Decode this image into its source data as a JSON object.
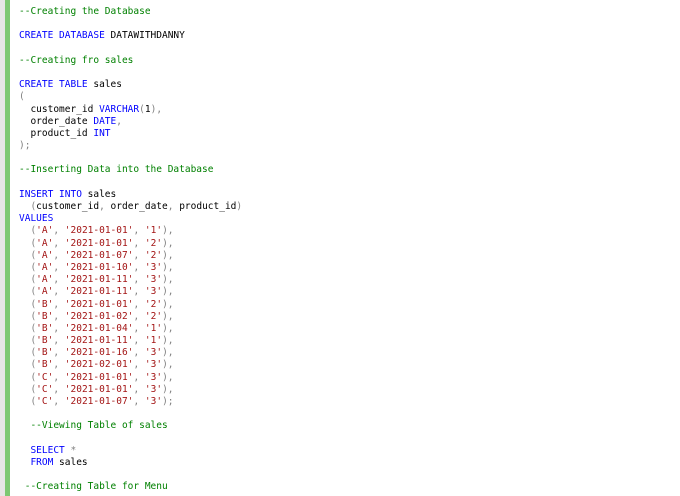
{
  "editor": {
    "lines": [
      [
        [
          "cm",
          "--Creating the Database"
        ]
      ],
      [],
      [
        [
          "kw",
          "CREATE DATABASE "
        ],
        [
          "id",
          "DATAWITHDANNY"
        ]
      ],
      [],
      [
        [
          "cm",
          "--Creating fro sales"
        ]
      ],
      [],
      [
        [
          "kw",
          "CREATE TABLE "
        ],
        [
          "id",
          "sales"
        ]
      ],
      [
        [
          "pu",
          "("
        ]
      ],
      [
        [
          "id",
          "  customer_id "
        ],
        [
          "kw",
          "VARCHAR"
        ],
        [
          "pu",
          "("
        ],
        [
          "id",
          "1"
        ],
        [
          "pu",
          "),"
        ]
      ],
      [
        [
          "id",
          "  order_date "
        ],
        [
          "kw",
          "DATE"
        ],
        [
          "pu",
          ","
        ]
      ],
      [
        [
          "id",
          "  product_id "
        ],
        [
          "kw",
          "INT"
        ]
      ],
      [
        [
          "pu",
          ");"
        ]
      ],
      [],
      [
        [
          "cm",
          "--Inserting Data into the Database"
        ]
      ],
      [],
      [
        [
          "kw",
          "INSERT INTO "
        ],
        [
          "id",
          "sales"
        ]
      ],
      [
        [
          "pu",
          "  ("
        ],
        [
          "id",
          "customer_id"
        ],
        [
          "pu",
          ", "
        ],
        [
          "id",
          "order_date"
        ],
        [
          "pu",
          ", "
        ],
        [
          "id",
          "product_id"
        ],
        [
          "pu",
          ")"
        ]
      ],
      [
        [
          "kw",
          "VALUES"
        ]
      ],
      [
        [
          "pu",
          "  ("
        ],
        [
          "st",
          "'A'"
        ],
        [
          "pu",
          ", "
        ],
        [
          "st",
          "'2021-01-01'"
        ],
        [
          "pu",
          ", "
        ],
        [
          "st",
          "'1'"
        ],
        [
          "pu",
          "),"
        ]
      ],
      [
        [
          "pu",
          "  ("
        ],
        [
          "st",
          "'A'"
        ],
        [
          "pu",
          ", "
        ],
        [
          "st",
          "'2021-01-01'"
        ],
        [
          "pu",
          ", "
        ],
        [
          "st",
          "'2'"
        ],
        [
          "pu",
          "),"
        ]
      ],
      [
        [
          "pu",
          "  ("
        ],
        [
          "st",
          "'A'"
        ],
        [
          "pu",
          ", "
        ],
        [
          "st",
          "'2021-01-07'"
        ],
        [
          "pu",
          ", "
        ],
        [
          "st",
          "'2'"
        ],
        [
          "pu",
          "),"
        ]
      ],
      [
        [
          "pu",
          "  ("
        ],
        [
          "st",
          "'A'"
        ],
        [
          "pu",
          ", "
        ],
        [
          "st",
          "'2021-01-10'"
        ],
        [
          "pu",
          ", "
        ],
        [
          "st",
          "'3'"
        ],
        [
          "pu",
          "),"
        ]
      ],
      [
        [
          "pu",
          "  ("
        ],
        [
          "st",
          "'A'"
        ],
        [
          "pu",
          ", "
        ],
        [
          "st",
          "'2021-01-11'"
        ],
        [
          "pu",
          ", "
        ],
        [
          "st",
          "'3'"
        ],
        [
          "pu",
          "),"
        ]
      ],
      [
        [
          "pu",
          "  ("
        ],
        [
          "st",
          "'A'"
        ],
        [
          "pu",
          ", "
        ],
        [
          "st",
          "'2021-01-11'"
        ],
        [
          "pu",
          ", "
        ],
        [
          "st",
          "'3'"
        ],
        [
          "pu",
          "),"
        ]
      ],
      [
        [
          "pu",
          "  ("
        ],
        [
          "st",
          "'B'"
        ],
        [
          "pu",
          ", "
        ],
        [
          "st",
          "'2021-01-01'"
        ],
        [
          "pu",
          ", "
        ],
        [
          "st",
          "'2'"
        ],
        [
          "pu",
          "),"
        ]
      ],
      [
        [
          "pu",
          "  ("
        ],
        [
          "st",
          "'B'"
        ],
        [
          "pu",
          ", "
        ],
        [
          "st",
          "'2021-01-02'"
        ],
        [
          "pu",
          ", "
        ],
        [
          "st",
          "'2'"
        ],
        [
          "pu",
          "),"
        ]
      ],
      [
        [
          "pu",
          "  ("
        ],
        [
          "st",
          "'B'"
        ],
        [
          "pu",
          ", "
        ],
        [
          "st",
          "'2021-01-04'"
        ],
        [
          "pu",
          ", "
        ],
        [
          "st",
          "'1'"
        ],
        [
          "pu",
          "),"
        ]
      ],
      [
        [
          "pu",
          "  ("
        ],
        [
          "st",
          "'B'"
        ],
        [
          "pu",
          ", "
        ],
        [
          "st",
          "'2021-01-11'"
        ],
        [
          "pu",
          ", "
        ],
        [
          "st",
          "'1'"
        ],
        [
          "pu",
          "),"
        ]
      ],
      [
        [
          "pu",
          "  ("
        ],
        [
          "st",
          "'B'"
        ],
        [
          "pu",
          ", "
        ],
        [
          "st",
          "'2021-01-16'"
        ],
        [
          "pu",
          ", "
        ],
        [
          "st",
          "'3'"
        ],
        [
          "pu",
          "),"
        ]
      ],
      [
        [
          "pu",
          "  ("
        ],
        [
          "st",
          "'B'"
        ],
        [
          "pu",
          ", "
        ],
        [
          "st",
          "'2021-02-01'"
        ],
        [
          "pu",
          ", "
        ],
        [
          "st",
          "'3'"
        ],
        [
          "pu",
          "),"
        ]
      ],
      [
        [
          "pu",
          "  ("
        ],
        [
          "st",
          "'C'"
        ],
        [
          "pu",
          ", "
        ],
        [
          "st",
          "'2021-01-01'"
        ],
        [
          "pu",
          ", "
        ],
        [
          "st",
          "'3'"
        ],
        [
          "pu",
          "),"
        ]
      ],
      [
        [
          "pu",
          "  ("
        ],
        [
          "st",
          "'C'"
        ],
        [
          "pu",
          ", "
        ],
        [
          "st",
          "'2021-01-01'"
        ],
        [
          "pu",
          ", "
        ],
        [
          "st",
          "'3'"
        ],
        [
          "pu",
          "),"
        ]
      ],
      [
        [
          "pu",
          "  ("
        ],
        [
          "st",
          "'C'"
        ],
        [
          "pu",
          ", "
        ],
        [
          "st",
          "'2021-01-07'"
        ],
        [
          "pu",
          ", "
        ],
        [
          "st",
          "'3'"
        ],
        [
          "pu",
          ");"
        ]
      ],
      [],
      [
        [
          "cm",
          "  --Viewing Table of sales"
        ]
      ],
      [],
      [
        [
          "kw",
          "  SELECT "
        ],
        [
          "pu",
          "*"
        ]
      ],
      [
        [
          "kw",
          "  FROM "
        ],
        [
          "id",
          "sales"
        ]
      ],
      [],
      [
        [
          "cm",
          " --Creating Table for Menu"
        ]
      ]
    ]
  },
  "colors": {
    "comment": "#008000",
    "keyword": "#0000ff",
    "string": "#a31515",
    "punctuation": "#808080",
    "gutter_change": "#7dc873"
  }
}
